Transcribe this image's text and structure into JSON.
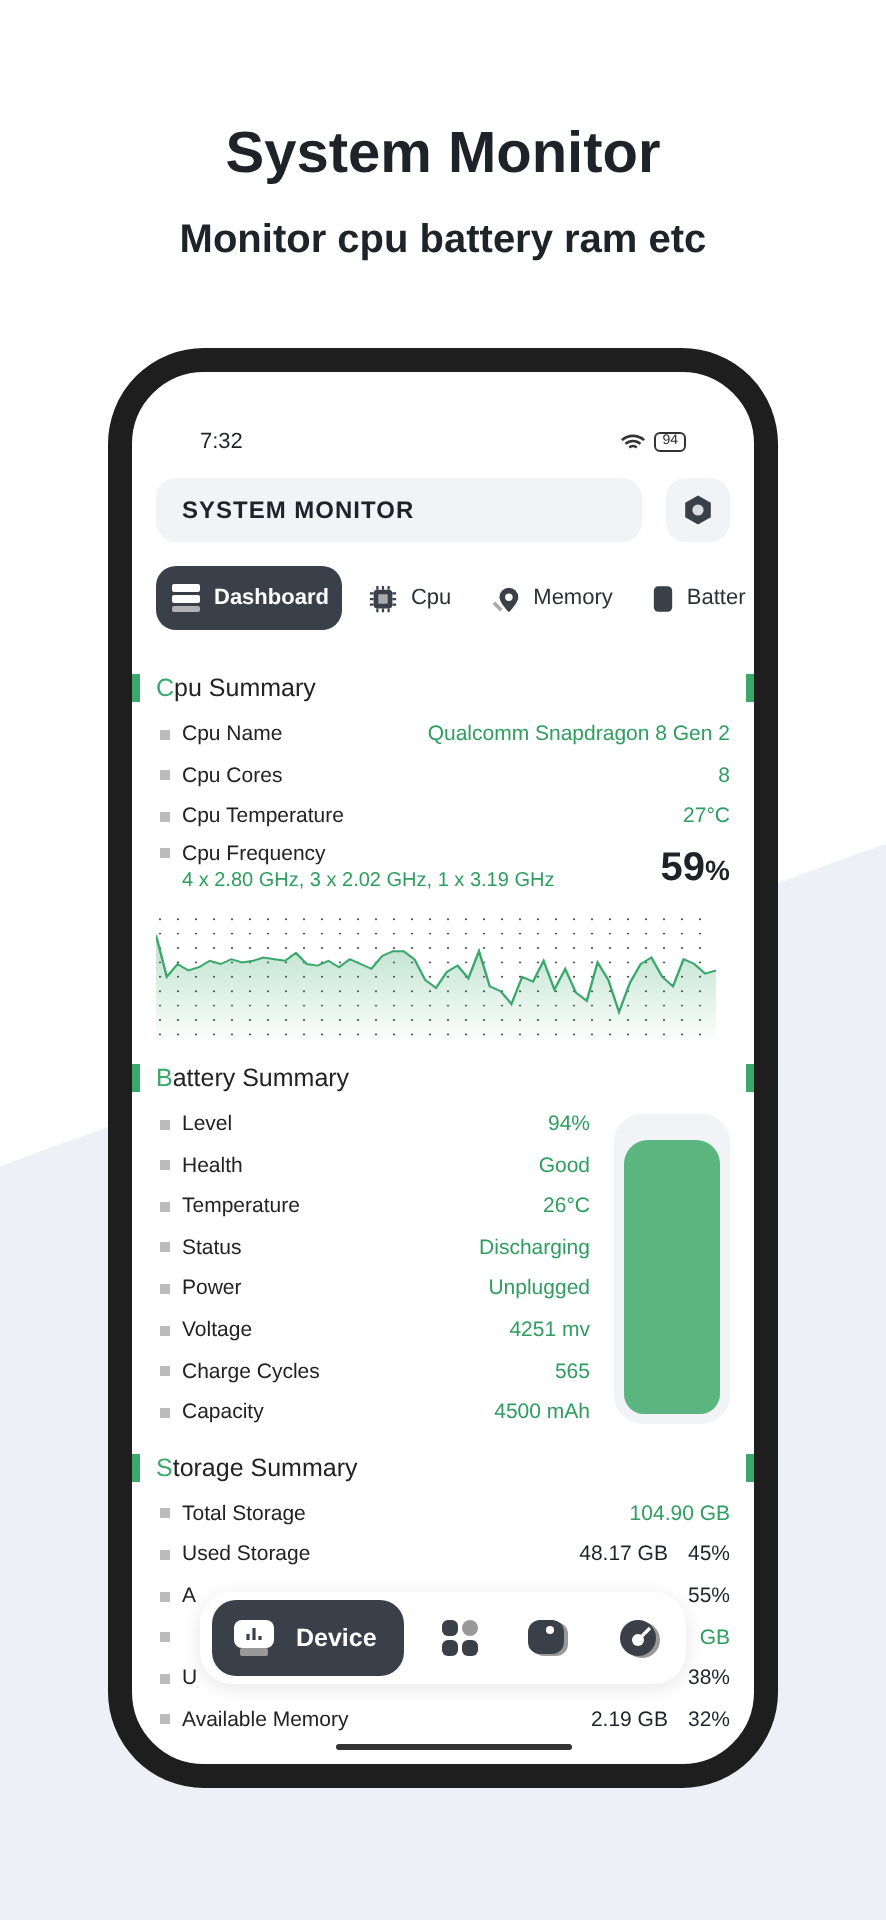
{
  "headline": "System Monitor",
  "subheadline": "Monitor cpu battery ram etc",
  "status_bar": {
    "time": "7:32",
    "battery": "94"
  },
  "app_bar": {
    "title": "SYSTEM MONITOR"
  },
  "tabs": [
    {
      "label": "Dashboard",
      "selected": true,
      "kind": "dashboard"
    },
    {
      "label": "Cpu",
      "selected": false,
      "kind": "cpu"
    },
    {
      "label": "Memory",
      "selected": false,
      "kind": "memory"
    },
    {
      "label": "Batter",
      "selected": false,
      "kind": "battery"
    }
  ],
  "cpu": {
    "initial": "C",
    "title": "pu Summary",
    "rows": [
      {
        "label": "Cpu Name",
        "value": "Qualcomm Snapdragon 8 Gen 2"
      },
      {
        "label": "Cpu Cores",
        "value": "8"
      },
      {
        "label": "Cpu Temperature",
        "value": "27°C"
      }
    ],
    "frequency": {
      "label": "Cpu Frequency",
      "value": "4 x 2.80 GHz, 3 x 2.02 GHz, 1 x 3.19 GHz"
    },
    "usage": "59",
    "usage_unit": "%"
  },
  "battery": {
    "initial": "B",
    "title": "attery Summary",
    "level": 0.94,
    "rows": [
      {
        "label": "Level",
        "value": "94%"
      },
      {
        "label": "Health",
        "value": "Good"
      },
      {
        "label": "Temperature",
        "value": "26°C"
      },
      {
        "label": "Status",
        "value": "Discharging"
      },
      {
        "label": "Power",
        "value": "Unplugged"
      },
      {
        "label": "Voltage",
        "value": "4251 mv"
      },
      {
        "label": "Charge Cycles",
        "value": "565"
      },
      {
        "label": "Capacity",
        "value": "4500 mAh"
      }
    ]
  },
  "storage": {
    "initial": "S",
    "title": "torage Summary",
    "rows": [
      {
        "label": "Total Storage",
        "value": "104.90 GB",
        "kind": "green"
      },
      {
        "label": "Used Storage",
        "value": "48.17 GB",
        "percent": "45%",
        "kind": "plain"
      },
      {
        "label": "A",
        "percent": "55%"
      },
      {
        "value": "GB",
        "kind": "green"
      },
      {
        "label": "U",
        "percent": "38%"
      },
      {
        "label": "Available Memory",
        "value": "2.19 GB",
        "percent": "32%",
        "kind": "plain"
      }
    ]
  },
  "bottom_nav": [
    {
      "label": "Device",
      "selected": true,
      "kind": "device"
    },
    {
      "selected": false,
      "kind": "apps"
    },
    {
      "selected": false,
      "kind": "sensor"
    },
    {
      "selected": false,
      "kind": "disk"
    }
  ]
}
